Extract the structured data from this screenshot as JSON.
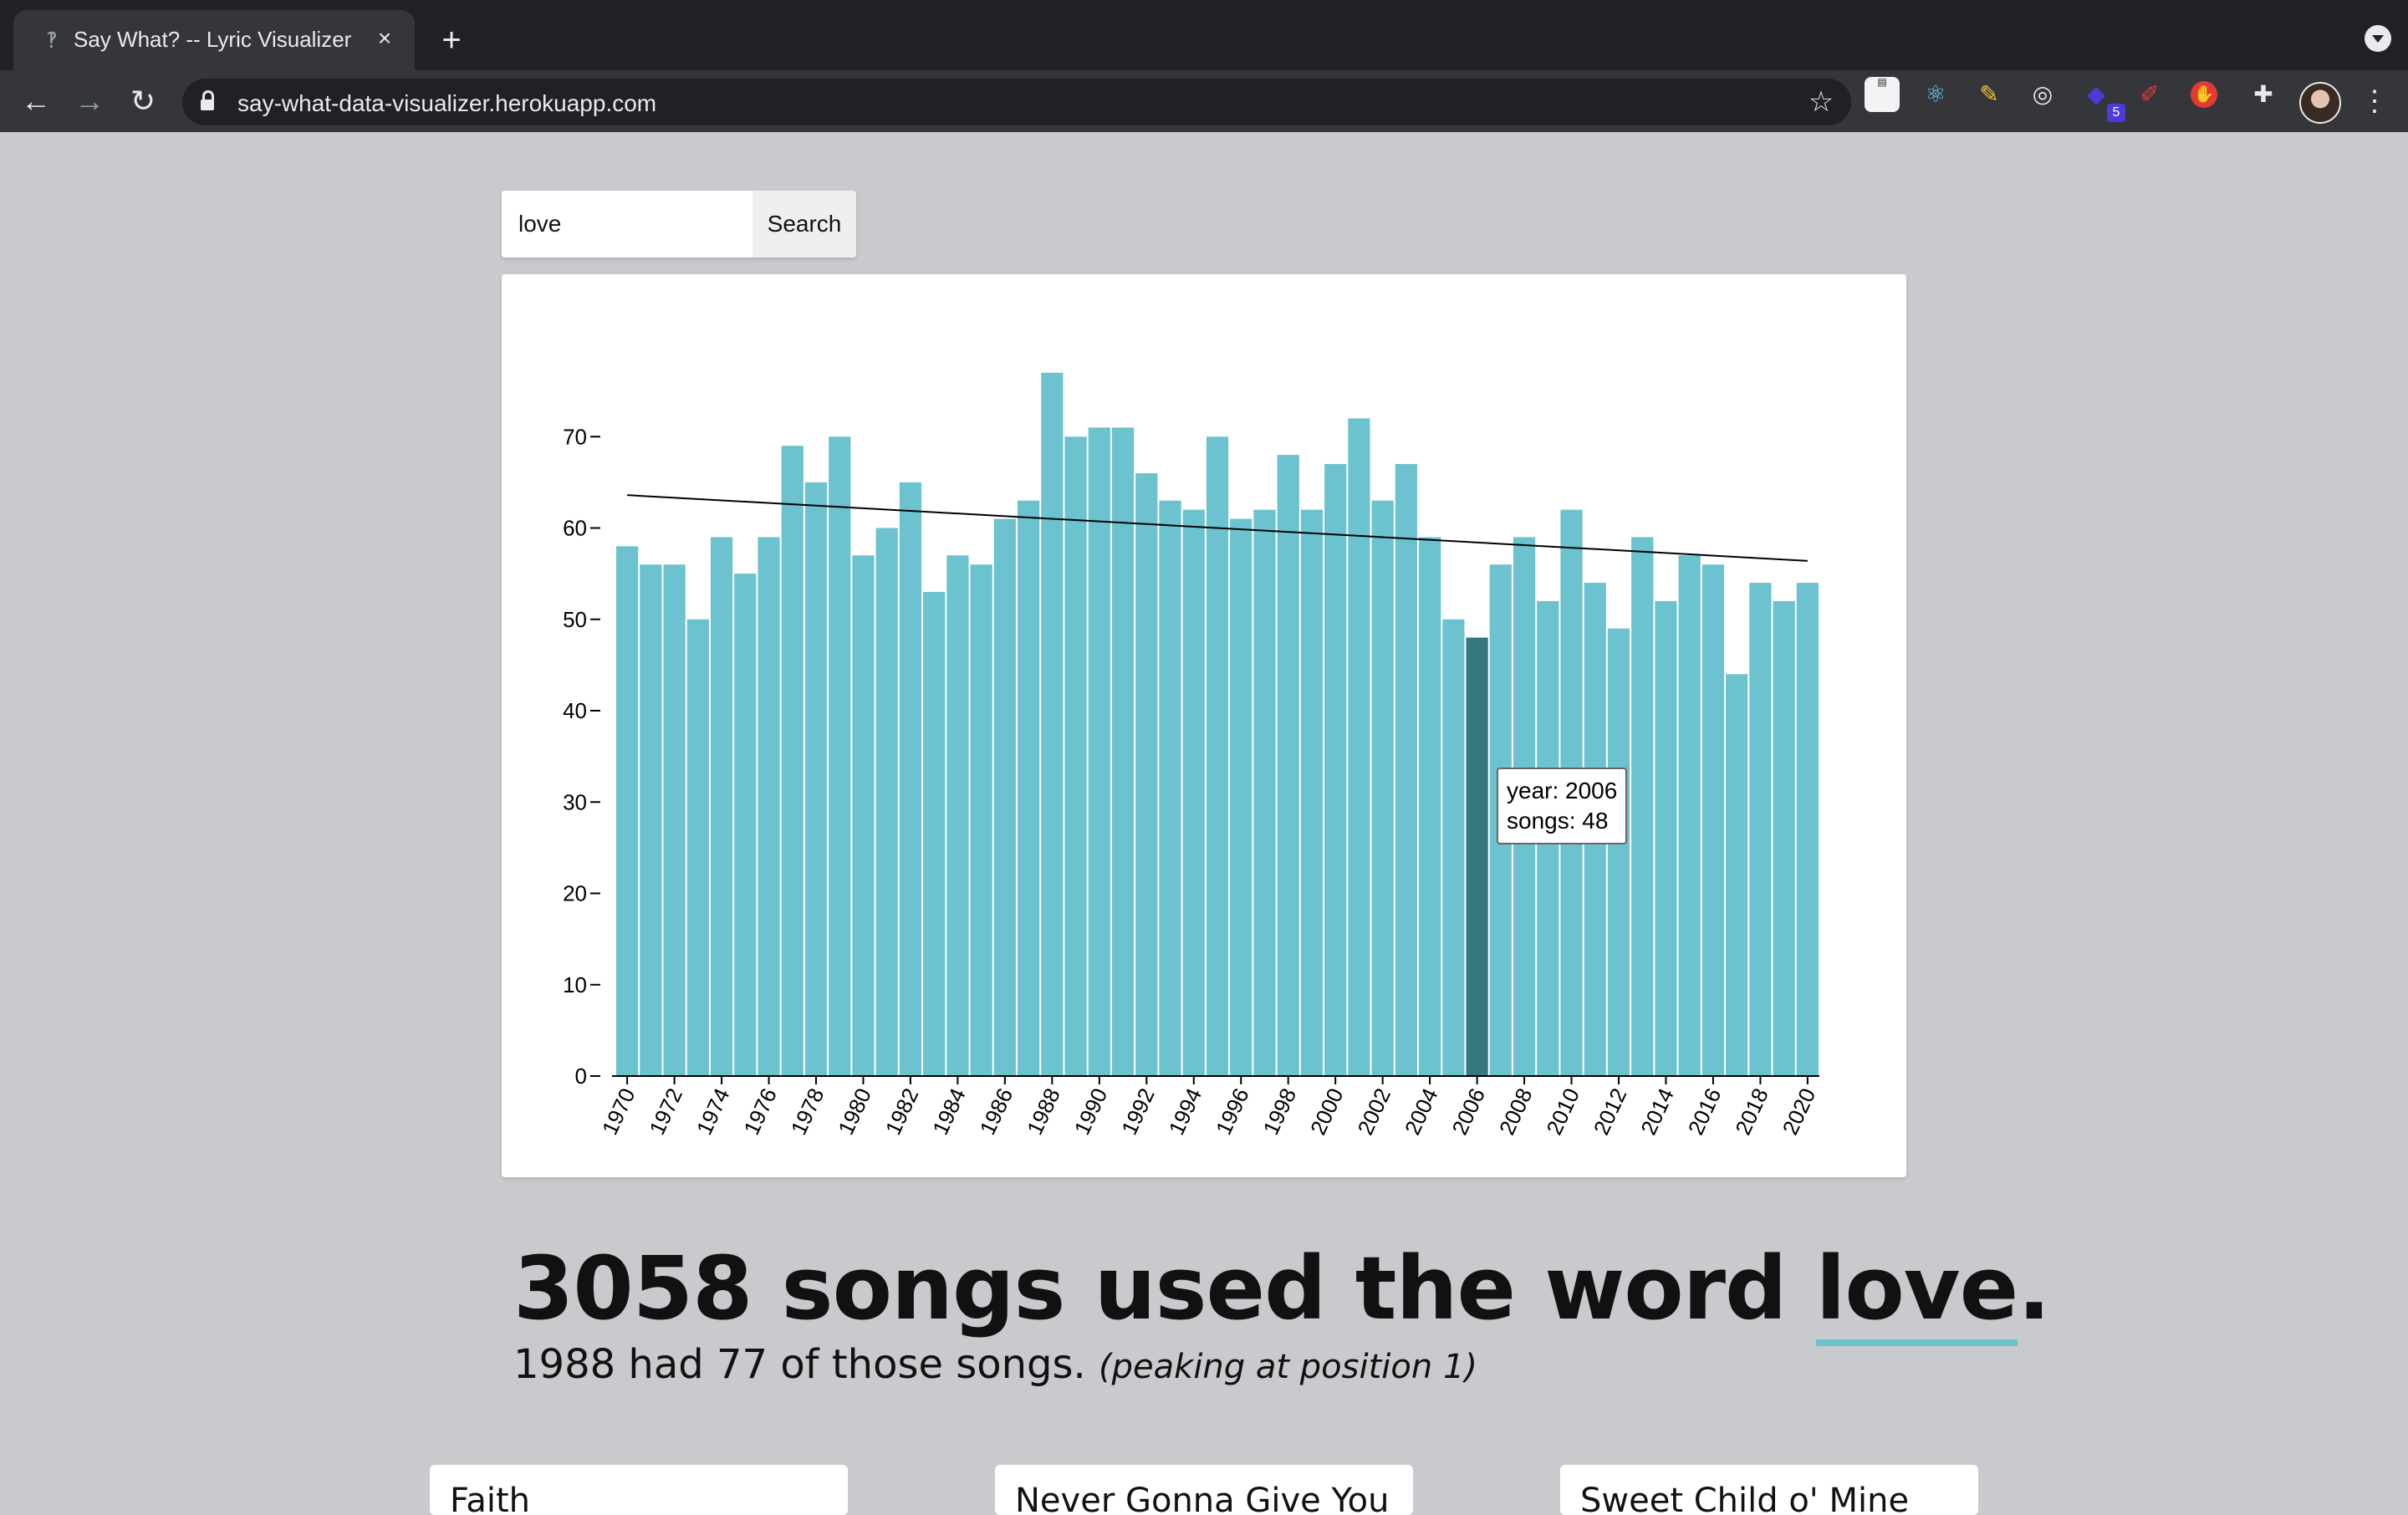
{
  "browser": {
    "tab_title": "Say What? -- Lyric Visualizer",
    "tab_close": "×",
    "new_tab": "+",
    "url": "say-what-data-visualizer.herokuapp.com",
    "extension_badge": "5"
  },
  "search": {
    "value": "love",
    "button_label": "Search"
  },
  "chart_data": {
    "type": "bar",
    "x": [
      1970,
      1971,
      1972,
      1973,
      1974,
      1975,
      1976,
      1977,
      1978,
      1979,
      1980,
      1981,
      1982,
      1983,
      1984,
      1985,
      1986,
      1987,
      1988,
      1989,
      1990,
      1991,
      1992,
      1993,
      1994,
      1995,
      1996,
      1997,
      1998,
      1999,
      2000,
      2001,
      2002,
      2003,
      2004,
      2005,
      2006,
      2007,
      2008,
      2009,
      2010,
      2011,
      2012,
      2013,
      2014,
      2015,
      2016,
      2017,
      2018,
      2019,
      2020
    ],
    "values": [
      58,
      56,
      56,
      50,
      59,
      55,
      59,
      69,
      65,
      70,
      57,
      60,
      65,
      53,
      57,
      56,
      61,
      63,
      77,
      70,
      71,
      71,
      66,
      63,
      62,
      70,
      61,
      62,
      68,
      62,
      67,
      72,
      63,
      67,
      59,
      50,
      48,
      56,
      59,
      52,
      62,
      54,
      49,
      59,
      52,
      57,
      56,
      44,
      54,
      52,
      54
    ],
    "tick_labels": [
      "1970",
      "1972",
      "1974",
      "1976",
      "1978",
      "1980",
      "1982",
      "1984",
      "1986",
      "1988",
      "1990",
      "1992",
      "1994",
      "1996",
      "1998",
      "2000",
      "2002",
      "2004",
      "2006",
      "2008",
      "2010",
      "2012",
      "2014",
      "2016",
      "2018",
      "2020"
    ],
    "y_ticks": [
      "0",
      "10",
      "20",
      "30",
      "40",
      "50",
      "60",
      "70"
    ],
    "ylim": [
      0,
      80
    ],
    "trend_line": {
      "start_value": 63.6,
      "end_value": 56.4
    },
    "bar_color": "#6cc2ce",
    "highlight_color": "#367880",
    "highlight_year": 2006,
    "title": "",
    "xlabel": "",
    "ylabel": ""
  },
  "tooltip": {
    "year_line": "year: 2006",
    "songs_line": "songs: 48"
  },
  "summary": {
    "headline_prefix": "3058 songs used the word ",
    "headline_word": "love",
    "headline_suffix": ".",
    "subline": "1988 had 77 of those songs. ",
    "subline_note": "(peaking at position 1)"
  },
  "songs": [
    {
      "title": "Faith"
    },
    {
      "title": "Never Gonna Give You"
    },
    {
      "title": "Sweet Child o' Mine"
    }
  ],
  "colors": {
    "page_bg": "#c9cacd",
    "accent": "#6cc2ce"
  }
}
